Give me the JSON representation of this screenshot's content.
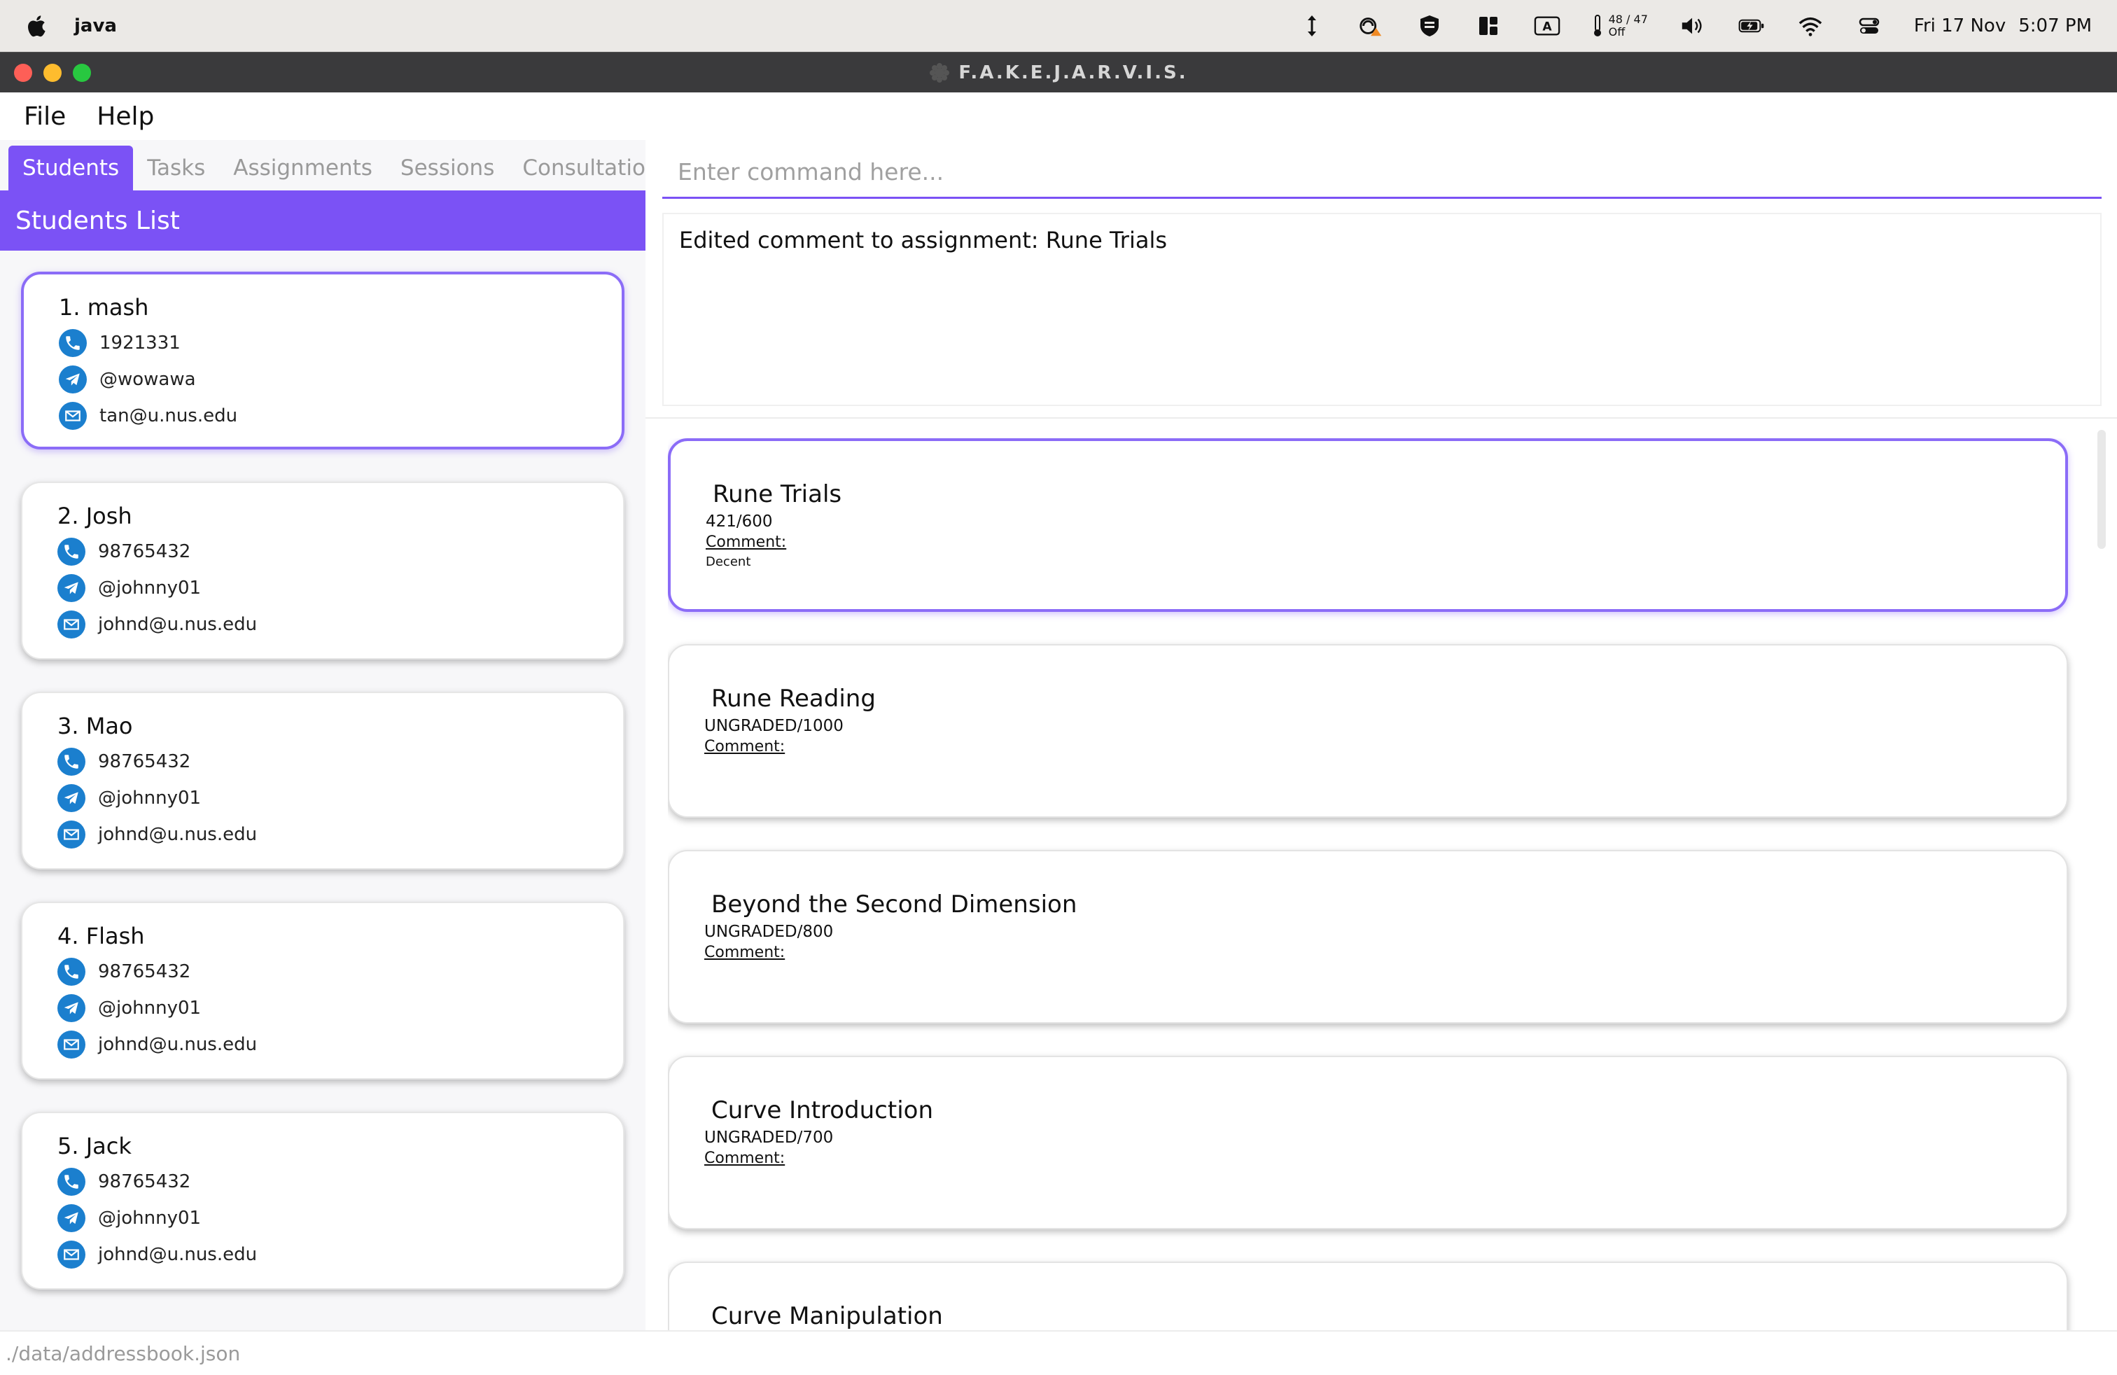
{
  "system": {
    "app_name": "java",
    "temperature": "48 / 47",
    "temperature_sub": "Off",
    "input_label": "A",
    "date": "Fri 17 Nov",
    "time": "5:07 PM"
  },
  "window": {
    "title": "F.A.K.E.J.A.R.V.I.S."
  },
  "menu": {
    "items": [
      "File",
      "Help"
    ]
  },
  "tabs": [
    {
      "label": "Students",
      "active": true
    },
    {
      "label": "Tasks",
      "active": false
    },
    {
      "label": "Assignments",
      "active": false
    },
    {
      "label": "Sessions",
      "active": false
    },
    {
      "label": "Consultations",
      "active": false
    }
  ],
  "students_header": "Students List",
  "students": [
    {
      "name": "1.  mash",
      "phone": "1921331",
      "telegram": "@wowawa",
      "email": "tan@u.nus.edu",
      "selected": true
    },
    {
      "name": "2.  Josh",
      "phone": "98765432",
      "telegram": "@johnny01",
      "email": "johnd@u.nus.edu",
      "selected": false
    },
    {
      "name": "3.  Mao",
      "phone": "98765432",
      "telegram": "@johnny01",
      "email": "johnd@u.nus.edu",
      "selected": false
    },
    {
      "name": "4.  Flash",
      "phone": "98765432",
      "telegram": "@johnny01",
      "email": "johnd@u.nus.edu",
      "selected": false
    },
    {
      "name": "5.  Jack",
      "phone": "98765432",
      "telegram": "@johnny01",
      "email": "johnd@u.nus.edu",
      "selected": false
    }
  ],
  "command": {
    "placeholder": "Enter command here...",
    "value": ""
  },
  "result": "Edited comment to assignment: Rune Trials",
  "assignments": [
    {
      "title": "Rune Trials",
      "grade": "421/600",
      "comment_label": "Comment:",
      "comment": "Decent",
      "selected": true
    },
    {
      "title": "Rune Reading",
      "grade": "UNGRADED/1000",
      "comment_label": "Comment:",
      "comment": "",
      "selected": false
    },
    {
      "title": "Beyond the Second Dimension",
      "grade": "UNGRADED/800",
      "comment_label": "Comment:",
      "comment": "",
      "selected": false
    },
    {
      "title": "Curve Introduction",
      "grade": "UNGRADED/700",
      "comment_label": "Comment:",
      "comment": "",
      "selected": false
    },
    {
      "title": "Curve Manipulation",
      "grade": "",
      "comment_label": "",
      "comment": "",
      "selected": false
    }
  ],
  "status_path": "./data/addressbook.json",
  "colors": {
    "accent": "#7b52f5",
    "icon_blue": "#1b7fce",
    "close": "#fe5f57",
    "minimize": "#febc2e",
    "maximize": "#28c840"
  }
}
